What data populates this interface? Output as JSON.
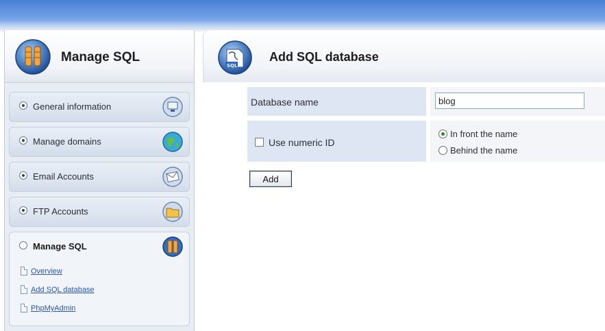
{
  "sidebar": {
    "title": "Manage SQL",
    "items": [
      {
        "label": "General information",
        "icon": "monitor-icon"
      },
      {
        "label": "Manage domains",
        "icon": "globe-icon"
      },
      {
        "label": "Email Accounts",
        "icon": "envelope-icon"
      },
      {
        "label": "FTP Accounts",
        "icon": "folder-icon"
      },
      {
        "label": "Manage SQL",
        "icon": "database-icon"
      }
    ],
    "sublinks": [
      {
        "label": "Overview"
      },
      {
        "label": "Add SQL database"
      },
      {
        "label": "PhpMyAdmin"
      }
    ]
  },
  "main": {
    "title": "Add SQL database",
    "header_icon_label": "SQL",
    "form": {
      "db_name_label": "Database name",
      "db_name_value": "blog",
      "numeric_id_label": "Use numeric ID",
      "numeric_id_checked": false,
      "position_options": [
        {
          "label": "In front the name",
          "selected": true
        },
        {
          "label": "Behind the name",
          "selected": false
        }
      ],
      "add_button_label": "Add"
    }
  },
  "colors": {
    "accent": "#4a80d4",
    "link": "#2d55b4",
    "label_bg": "#dfe6f3"
  }
}
